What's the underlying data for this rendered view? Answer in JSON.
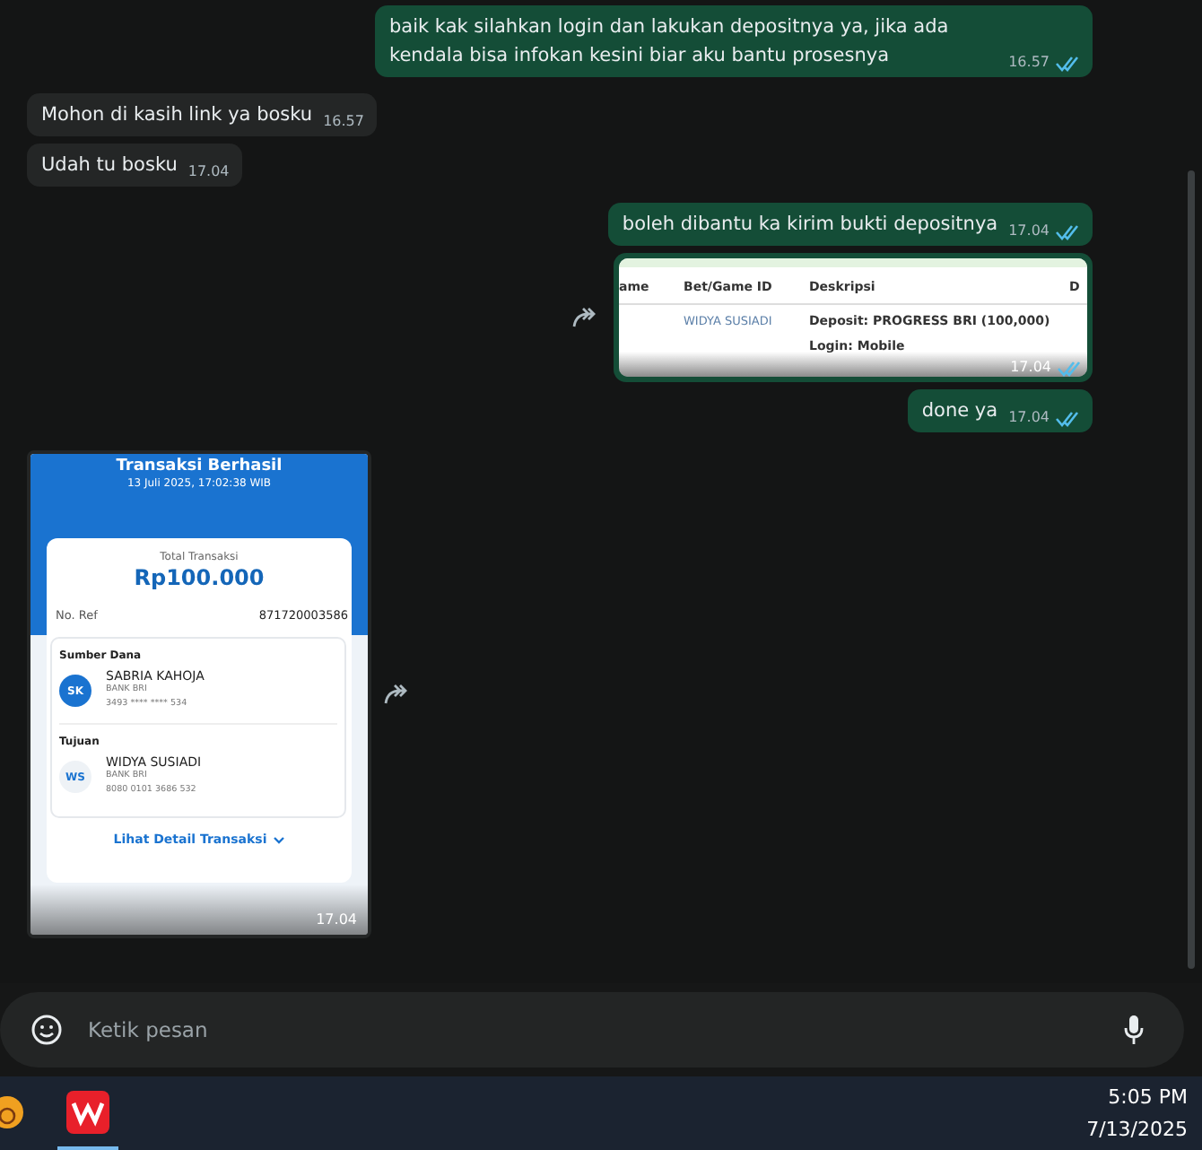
{
  "messages": [
    {
      "kind": "text",
      "outgoing": true,
      "text": "baik kak silahkan login dan lakukan depositnya ya, jika ada kendala bisa infokan kesini biar aku bantu prosesnya",
      "time": "16.57",
      "read": true
    },
    {
      "kind": "text",
      "outgoing": false,
      "text": "Mohon di kasih link ya bosku",
      "time": "16.57"
    },
    {
      "kind": "text",
      "outgoing": false,
      "text": "Udah tu bosku",
      "time": "17.04"
    },
    {
      "kind": "text",
      "outgoing": true,
      "text": "boleh dibantu ka kirim bukti depositnya",
      "time": "17.04",
      "read": true
    },
    {
      "kind": "table_image",
      "outgoing": true,
      "forward": true,
      "columns": [
        "ame",
        "Bet/Game ID",
        "Deskripsi",
        "D"
      ],
      "rows": [
        {
          "id": "WIDYA SUSIADI",
          "description": "Deposit: PROGRESS BRI (100,000)"
        },
        {
          "description": "Login: Mobile"
        }
      ],
      "time": "17.04",
      "read": true
    },
    {
      "kind": "text",
      "outgoing": true,
      "text": "done ya",
      "time": "17.04",
      "read": true
    },
    {
      "kind": "receipt_image",
      "outgoing": false,
      "forward": true,
      "title": "Transaksi Berhasil",
      "datetime": "13 Juli 2025, 17:02:38 WIB",
      "total_label": "Total Transaksi",
      "total": "Rp100.000",
      "ref_label": "No. Ref",
      "ref": "871720003586",
      "parties": [
        {
          "label": "Sumber Dana",
          "initials": "SK",
          "filled": true,
          "name": "SABRIA KAHOJA",
          "bank": "BANK BRI",
          "account": "3493 **** **** 534"
        },
        {
          "label": "Tujuan",
          "initials": "WS",
          "filled": false,
          "name": "WIDYA SUSIADI",
          "bank": "BANK BRI",
          "account": "8080 0101 3686 532"
        }
      ],
      "link": "Lihat Detail Transaksi",
      "time": "17.04"
    }
  ],
  "composer": {
    "placeholder": "Ketik pesan"
  },
  "taskbar": {
    "apps": [
      {
        "kind": "orange",
        "active": false
      },
      {
        "kind": "office",
        "active": true
      }
    ],
    "time": "5:05 PM",
    "date": "7/13/2025"
  }
}
